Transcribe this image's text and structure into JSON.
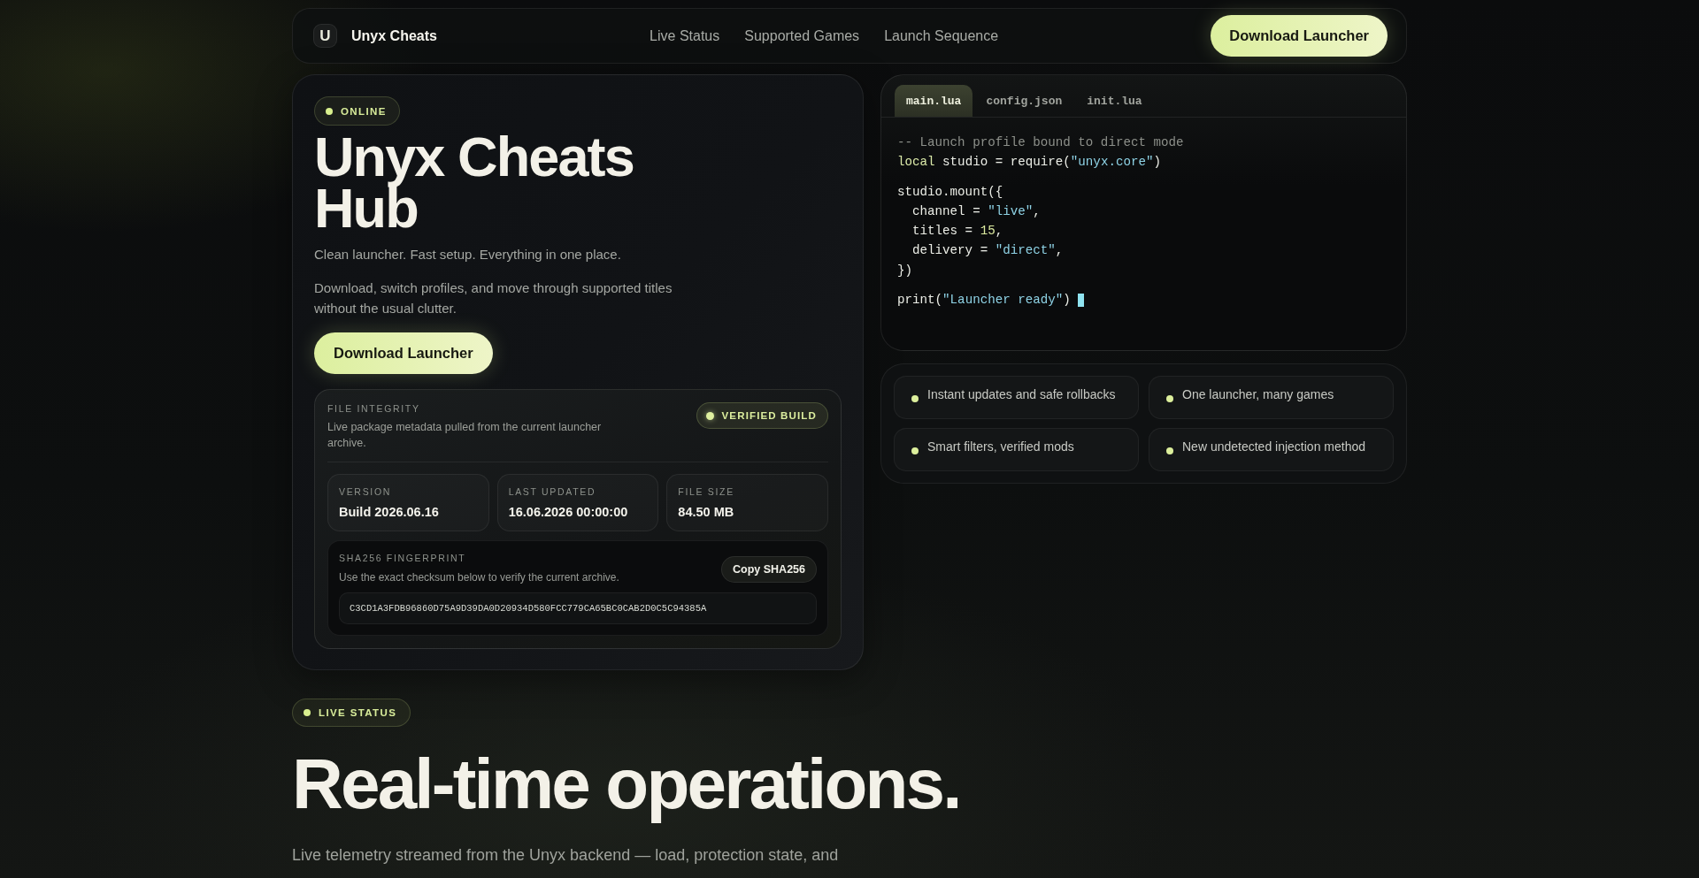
{
  "nav": {
    "logo_letter": "U",
    "brand": "Unyx Cheats",
    "links": [
      "Live Status",
      "Supported Games",
      "Launch Sequence"
    ],
    "cta": "Download Launcher"
  },
  "hero": {
    "badge": "ONLINE",
    "title": "Unyx Cheats Hub",
    "tagline": "Clean launcher. Fast setup. Everything in one place.",
    "description": "Download, switch profiles, and move through supported titles without the usual clutter.",
    "cta": "Download Launcher",
    "file_integrity": {
      "label": "FILE INTEGRITY",
      "description": "Live package metadata pulled from the current launcher archive.",
      "badge": "VERIFIED BUILD",
      "stats": [
        {
          "label": "VERSION",
          "value": "Build 2026.06.16"
        },
        {
          "label": "LAST UPDATED",
          "value": "16.06.2026 00:00:00"
        },
        {
          "label": "FILE SIZE",
          "value": "84.50 MB"
        }
      ],
      "fingerprint": {
        "label": "SHA256 FINGERPRINT",
        "description": "Use the exact checksum below to verify the current archive.",
        "button": "Copy SHA256",
        "hash": "C3CD1A3FDB96860D75A9D39DA0D20934D580FCC779CA65BC0CAB2D0C5C94385A"
      }
    }
  },
  "editor": {
    "tabs": [
      {
        "label": "main.lua",
        "selected": true
      },
      {
        "label": "config.json",
        "selected": false
      },
      {
        "label": "init.lua",
        "selected": false
      }
    ],
    "blocks": [
      [
        [
          {
            "kind": "comment",
            "text": "-- Launch profile bound to direct mode"
          }
        ],
        [
          {
            "kind": "keyword",
            "text": "local"
          },
          {
            "kind": "plain",
            "text": " studio = require("
          },
          {
            "kind": "string",
            "text": "\"unyx.core\""
          },
          {
            "kind": "plain",
            "text": ")"
          }
        ]
      ],
      [
        [
          {
            "kind": "plain",
            "text": "studio.mount({"
          }
        ],
        [
          {
            "kind": "plain",
            "text": "  channel = "
          },
          {
            "kind": "string",
            "text": "\"live\""
          },
          {
            "kind": "plain",
            "text": ","
          }
        ],
        [
          {
            "kind": "plain",
            "text": "  titles = "
          },
          {
            "kind": "number",
            "text": "15"
          },
          {
            "kind": "plain",
            "text": ","
          }
        ],
        [
          {
            "kind": "plain",
            "text": "  delivery = "
          },
          {
            "kind": "string",
            "text": "\"direct\""
          },
          {
            "kind": "plain",
            "text": ","
          }
        ],
        [
          {
            "kind": "plain",
            "text": "})"
          }
        ]
      ],
      [
        [
          {
            "kind": "plain",
            "text": "print("
          },
          {
            "kind": "string",
            "text": "\"Launcher ready\""
          },
          {
            "kind": "plain",
            "text": ")"
          }
        ]
      ]
    ]
  },
  "features": [
    "Instant updates and safe rollbacks",
    "One launcher, many games",
    "Smart filters, verified mods",
    "New undetected injection method"
  ],
  "live_status": {
    "badge": "LIVE STATUS",
    "title": "Real-time operations.",
    "description": "Live telemetry streamed from the Unyx backend — load, protection state, and"
  }
}
